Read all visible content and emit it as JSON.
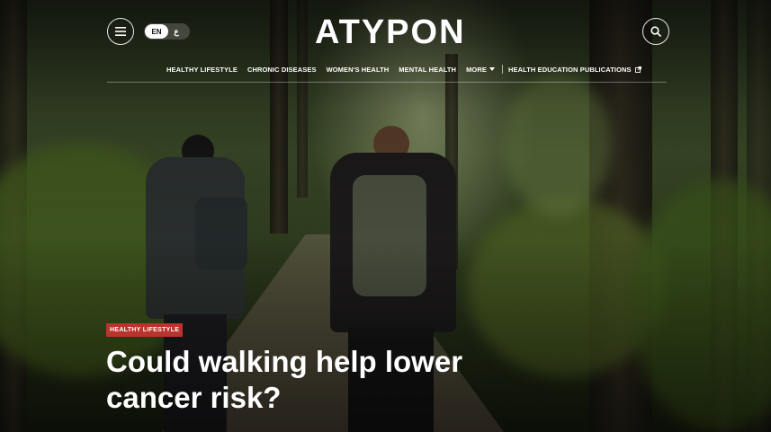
{
  "header": {
    "logo": "ATYPON",
    "menu_icon": "hamburger-menu-icon",
    "search_icon": "search-icon",
    "language": {
      "selected": "EN",
      "other": "ع"
    }
  },
  "nav": {
    "items": [
      "HEALTHY LIFESTYLE",
      "CHRONIC DISEASES",
      "WOMEN'S HEALTH",
      "MENTAL HEALTH",
      "MORE"
    ],
    "more_icon": "caret-down-icon",
    "external_link": "HEALTH EDUCATION PUBLICATIONS",
    "external_icon": "external-link-icon"
  },
  "hero": {
    "category": "HEALTHY LIFESTYLE",
    "headline": "Could walking help lower cancer risk?",
    "category_color": "#b9342c"
  }
}
